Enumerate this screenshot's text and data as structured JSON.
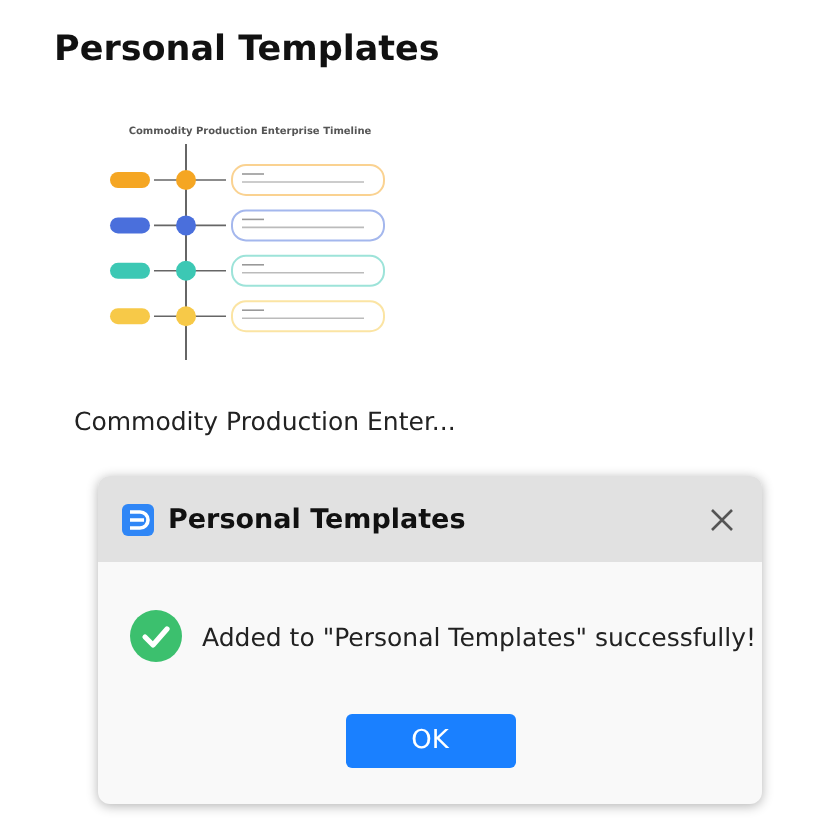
{
  "page": {
    "title": "Personal Templates"
  },
  "templates": [
    {
      "caption": "Commodity Production Enter...",
      "preview": {
        "title": "Commodity Production Enterprise Timeline",
        "nodes": [
          {
            "color": "#f5a623"
          },
          {
            "color": "#4a6fdc"
          },
          {
            "color": "#3cc8b4"
          },
          {
            "color": "#f7c948"
          }
        ]
      }
    }
  ],
  "dialog": {
    "title": "Personal Templates",
    "message": "Added to \"Personal Templates\" successfully!",
    "buttons": [
      "OK"
    ]
  }
}
